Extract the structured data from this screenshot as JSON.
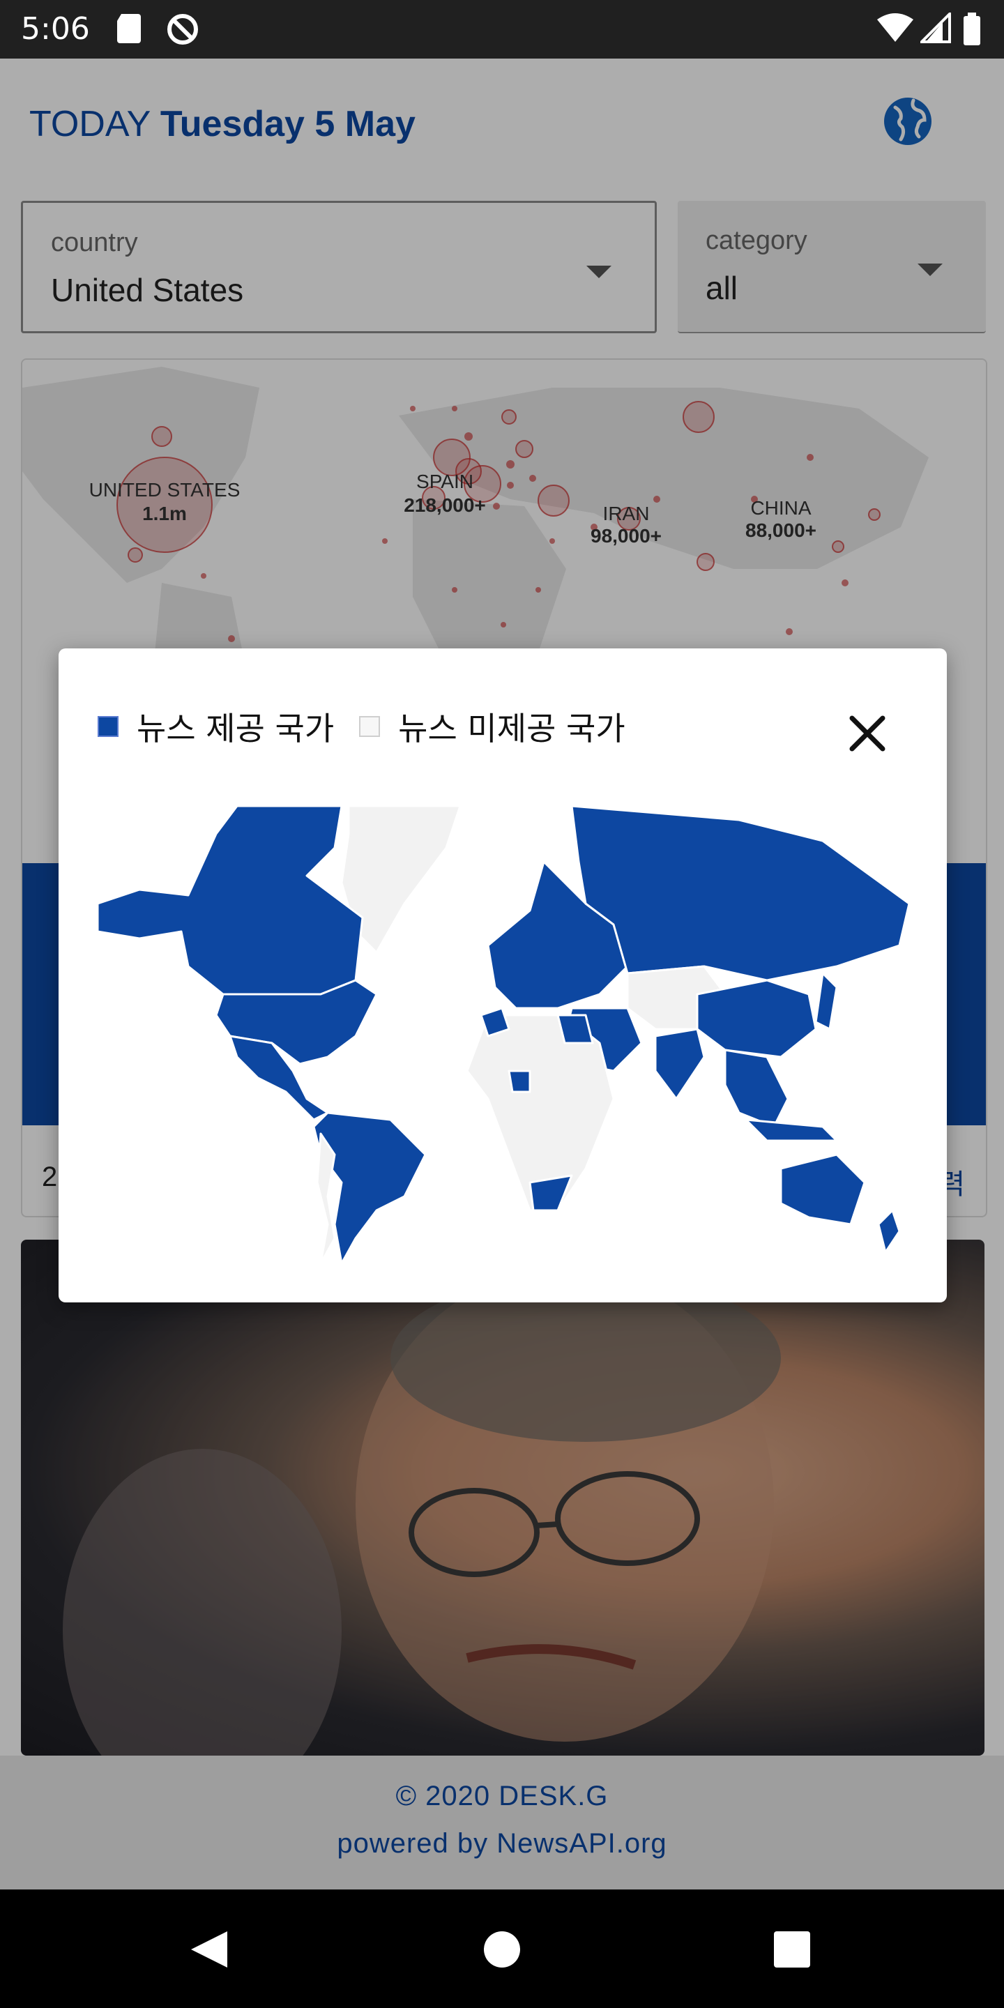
{
  "status_bar": {
    "time": "5:06"
  },
  "header": {
    "today_label": "TODAY",
    "date": "Tuesday 5 May"
  },
  "filters": {
    "country": {
      "label": "country",
      "value": "United States"
    },
    "category": {
      "label": "category",
      "value": "all"
    }
  },
  "covid_map": {
    "labels": [
      {
        "name": "UNITED STATES",
        "value": "1.1m"
      },
      {
        "name": "SPAIN",
        "value": "218,000+"
      },
      {
        "name": "IRAN",
        "value": "98,000+"
      },
      {
        "name": "CHINA",
        "value": "88,000+"
      }
    ]
  },
  "card": {
    "left_text": "2",
    "right_text": "력"
  },
  "dialog": {
    "legend_provided": "뉴스 제공 국가",
    "legend_not_provided": "뉴스 미제공 국가",
    "colors": {
      "provided": "#0d47a1",
      "not_provided": "#f2f2f2"
    }
  },
  "footer": {
    "copyright": "© 2020 DESK.G",
    "powered": "powered by NewsAPI.org"
  }
}
